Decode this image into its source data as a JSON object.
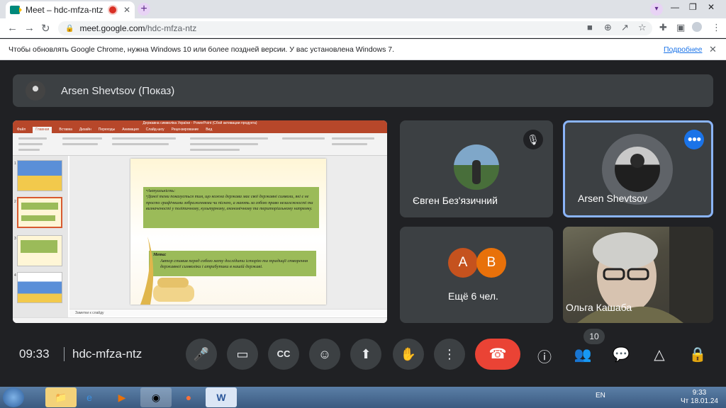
{
  "browser": {
    "tab_title": "Meet – hdc-mfza-ntz",
    "tab_close": "✕",
    "new_tab": "+",
    "url_host": "meet.google.com",
    "url_path": "/hdc-mfza-ntz",
    "window_controls": [
      "—",
      "❐",
      "✕"
    ]
  },
  "infobar": {
    "message": "Чтобы обновлять Google Chrome, нужна Windows 10 или более поздней версии. У вас установлена Windows 7.",
    "link": "Подробнее",
    "close": "✕"
  },
  "presenter": {
    "name": "Arsen Shevtsov (Показ)"
  },
  "powerpoint": {
    "window_title": "Державна символіка України - PowerPoint (Сбой активации продукта)",
    "ribbon_tabs": [
      "Файл",
      "Главная",
      "Вставка",
      "Дизайн",
      "Переходы",
      "Анимация",
      "Слайд-шоу",
      "Рецензирование",
      "Вид"
    ],
    "notes_placeholder": "Заметки к слайду",
    "slide": {
      "heading1": "•Актуальність:",
      "body1": "•Даної теми показується тим, що кожна держава має свої державні символи, які є не просто графічними зображеннями чи піснею, а мають за собою право незалежності та визначеності у політичному, культурному, економічному та територіальному напрямку.",
      "heading2": "Мета:",
      "body2": "Автор ставив перед собою мету дослідити історію та традиції створення державної символіки і атрибутики в нашій державі."
    },
    "thumb_numbers": [
      "1",
      "2",
      "3",
      "4"
    ]
  },
  "participants": {
    "tile1_name": "Євген Без'язичний",
    "tile2_name": "Arsen Shevtsov",
    "tile3_more": "Ещё 6 чел.",
    "tile3_avatars": [
      {
        "letter": "A",
        "color": "#c5521e"
      },
      {
        "letter": "B",
        "color": "#e8710a"
      }
    ],
    "tile4_name": "Ольга Кашаба"
  },
  "controls": {
    "time": "09:33",
    "meeting_code": "hdc-mfza-ntz",
    "participant_count": "10"
  },
  "taskbar": {
    "lang": "EN",
    "clock_time": "9:33",
    "clock_date": "Чт 18.01.24"
  },
  "colors": {
    "meet_bg": "#202124",
    "tile_bg": "#3c4043",
    "hangup": "#ea4335",
    "accent": "#8ab4f8",
    "ppt_red": "#b7472a",
    "slide_green": "#9bbb59"
  }
}
